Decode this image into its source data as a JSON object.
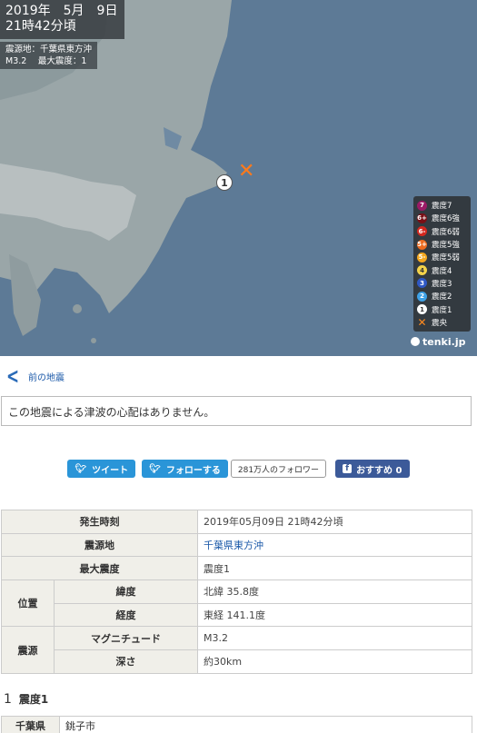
{
  "map": {
    "date_line": "2019年　5月　9日",
    "time_line": "21時42分頃",
    "epicenter_line": "震源地：千葉県東方沖",
    "magnitude_line": "M3.2　 最大震度：1",
    "observation_marker": "1",
    "epicenter_marker": "✕",
    "credit": "tenki.jp",
    "legend": [
      {
        "symbol": "7",
        "label": "震度7",
        "color": "#9b1a66"
      },
      {
        "symbol": "6+",
        "label": "震度6強",
        "color": "#7a0f15"
      },
      {
        "symbol": "6-",
        "label": "震度6弱",
        "color": "#d3281f"
      },
      {
        "symbol": "5+",
        "label": "震度5強",
        "color": "#ec6b1f"
      },
      {
        "symbol": "5-",
        "label": "震度5弱",
        "color": "#f4a81f"
      },
      {
        "symbol": "4",
        "label": "震度4",
        "color": "#f3d24a"
      },
      {
        "symbol": "3",
        "label": "震度3",
        "color": "#2f58c4"
      },
      {
        "symbol": "2",
        "label": "震度2",
        "color": "#3ea1e6"
      },
      {
        "symbol": "1",
        "label": "震度1",
        "color": "#ffffff"
      },
      {
        "symbol": "✕",
        "label": "震央",
        "color": "#ff8a1f"
      }
    ]
  },
  "nav": {
    "back_label": "前の地震"
  },
  "notice": "この地震による津波の心配はありません。",
  "social": {
    "tweet_label": "ツイート",
    "follow_label": "フォローする",
    "followers_label": "281万人のフォロワー",
    "facebook_label": "おすすめ 0"
  },
  "info": {
    "time_label": "発生時刻",
    "time_value": "2019年05月09日 21時42分頃",
    "epicenter_label": "震源地",
    "epicenter_value": "千葉県東方沖",
    "max_intensity_label": "最大震度",
    "max_intensity_value": "震度1",
    "position_label": "位置",
    "latitude_label": "緯度",
    "latitude_value": "北緯 35.8度",
    "longitude_label": "経度",
    "longitude_value": "東経 141.1度",
    "source_label": "震源",
    "magnitude_label": "マグニチュード",
    "magnitude_value": "M3.2",
    "depth_label": "深さ",
    "depth_value": "約30km"
  },
  "intensity_section": {
    "icon": "1",
    "title": "震度1",
    "prefecture": "千葉県",
    "cities": "銚子市"
  }
}
